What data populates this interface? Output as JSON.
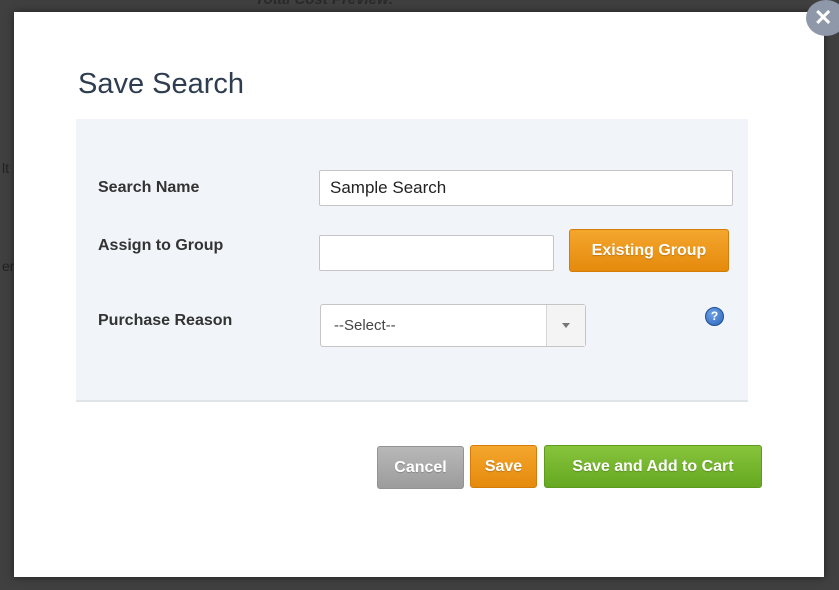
{
  "background": {
    "text": "Total Cost Preview:",
    "fragments": [
      "lt",
      "er"
    ]
  },
  "dialog": {
    "title": "Save Search",
    "close_icon": "close-icon",
    "fields": {
      "search_name": {
        "label": "Search Name",
        "value": "Sample Search"
      },
      "assign_group": {
        "label": "Assign to Group",
        "value": "",
        "button_label": "Existing Group"
      },
      "purchase_reason": {
        "label": "Purchase Reason",
        "selected": "--Select--",
        "help_icon": "question-icon"
      }
    },
    "buttons": {
      "cancel": "Cancel",
      "save": "Save",
      "save_add_cart": "Save and Add to Cart"
    }
  },
  "colors": {
    "orange": "#e8910f",
    "green": "#6cb02a",
    "gray": "#a8a8a8",
    "title": "#2e3d4f",
    "panel": "#f1f5f9"
  }
}
